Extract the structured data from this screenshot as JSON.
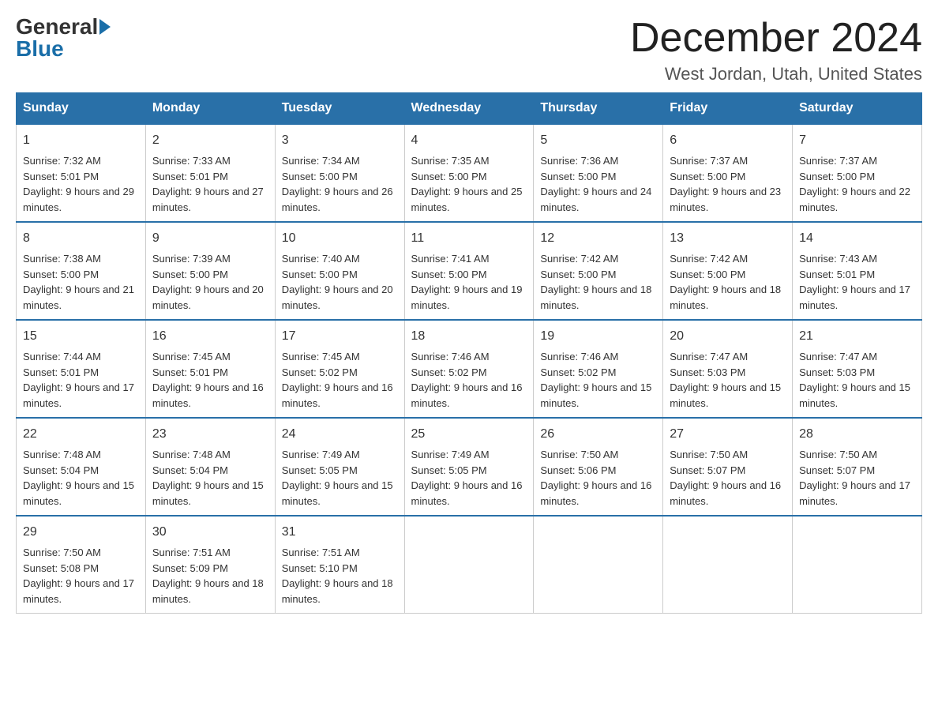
{
  "logo": {
    "general": "General",
    "blue": "Blue",
    "arrow": "▶"
  },
  "title": "December 2024",
  "location": "West Jordan, Utah, United States",
  "days_of_week": [
    "Sunday",
    "Monday",
    "Tuesday",
    "Wednesday",
    "Thursday",
    "Friday",
    "Saturday"
  ],
  "weeks": [
    [
      {
        "day": "1",
        "sunrise": "7:32 AM",
        "sunset": "5:01 PM",
        "daylight": "9 hours and 29 minutes."
      },
      {
        "day": "2",
        "sunrise": "7:33 AM",
        "sunset": "5:01 PM",
        "daylight": "9 hours and 27 minutes."
      },
      {
        "day": "3",
        "sunrise": "7:34 AM",
        "sunset": "5:00 PM",
        "daylight": "9 hours and 26 minutes."
      },
      {
        "day": "4",
        "sunrise": "7:35 AM",
        "sunset": "5:00 PM",
        "daylight": "9 hours and 25 minutes."
      },
      {
        "day": "5",
        "sunrise": "7:36 AM",
        "sunset": "5:00 PM",
        "daylight": "9 hours and 24 minutes."
      },
      {
        "day": "6",
        "sunrise": "7:37 AM",
        "sunset": "5:00 PM",
        "daylight": "9 hours and 23 minutes."
      },
      {
        "day": "7",
        "sunrise": "7:37 AM",
        "sunset": "5:00 PM",
        "daylight": "9 hours and 22 minutes."
      }
    ],
    [
      {
        "day": "8",
        "sunrise": "7:38 AM",
        "sunset": "5:00 PM",
        "daylight": "9 hours and 21 minutes."
      },
      {
        "day": "9",
        "sunrise": "7:39 AM",
        "sunset": "5:00 PM",
        "daylight": "9 hours and 20 minutes."
      },
      {
        "day": "10",
        "sunrise": "7:40 AM",
        "sunset": "5:00 PM",
        "daylight": "9 hours and 20 minutes."
      },
      {
        "day": "11",
        "sunrise": "7:41 AM",
        "sunset": "5:00 PM",
        "daylight": "9 hours and 19 minutes."
      },
      {
        "day": "12",
        "sunrise": "7:42 AM",
        "sunset": "5:00 PM",
        "daylight": "9 hours and 18 minutes."
      },
      {
        "day": "13",
        "sunrise": "7:42 AM",
        "sunset": "5:00 PM",
        "daylight": "9 hours and 18 minutes."
      },
      {
        "day": "14",
        "sunrise": "7:43 AM",
        "sunset": "5:01 PM",
        "daylight": "9 hours and 17 minutes."
      }
    ],
    [
      {
        "day": "15",
        "sunrise": "7:44 AM",
        "sunset": "5:01 PM",
        "daylight": "9 hours and 17 minutes."
      },
      {
        "day": "16",
        "sunrise": "7:45 AM",
        "sunset": "5:01 PM",
        "daylight": "9 hours and 16 minutes."
      },
      {
        "day": "17",
        "sunrise": "7:45 AM",
        "sunset": "5:02 PM",
        "daylight": "9 hours and 16 minutes."
      },
      {
        "day": "18",
        "sunrise": "7:46 AM",
        "sunset": "5:02 PM",
        "daylight": "9 hours and 16 minutes."
      },
      {
        "day": "19",
        "sunrise": "7:46 AM",
        "sunset": "5:02 PM",
        "daylight": "9 hours and 15 minutes."
      },
      {
        "day": "20",
        "sunrise": "7:47 AM",
        "sunset": "5:03 PM",
        "daylight": "9 hours and 15 minutes."
      },
      {
        "day": "21",
        "sunrise": "7:47 AM",
        "sunset": "5:03 PM",
        "daylight": "9 hours and 15 minutes."
      }
    ],
    [
      {
        "day": "22",
        "sunrise": "7:48 AM",
        "sunset": "5:04 PM",
        "daylight": "9 hours and 15 minutes."
      },
      {
        "day": "23",
        "sunrise": "7:48 AM",
        "sunset": "5:04 PM",
        "daylight": "9 hours and 15 minutes."
      },
      {
        "day": "24",
        "sunrise": "7:49 AM",
        "sunset": "5:05 PM",
        "daylight": "9 hours and 15 minutes."
      },
      {
        "day": "25",
        "sunrise": "7:49 AM",
        "sunset": "5:05 PM",
        "daylight": "9 hours and 16 minutes."
      },
      {
        "day": "26",
        "sunrise": "7:50 AM",
        "sunset": "5:06 PM",
        "daylight": "9 hours and 16 minutes."
      },
      {
        "day": "27",
        "sunrise": "7:50 AM",
        "sunset": "5:07 PM",
        "daylight": "9 hours and 16 minutes."
      },
      {
        "day": "28",
        "sunrise": "7:50 AM",
        "sunset": "5:07 PM",
        "daylight": "9 hours and 17 minutes."
      }
    ],
    [
      {
        "day": "29",
        "sunrise": "7:50 AM",
        "sunset": "5:08 PM",
        "daylight": "9 hours and 17 minutes."
      },
      {
        "day": "30",
        "sunrise": "7:51 AM",
        "sunset": "5:09 PM",
        "daylight": "9 hours and 18 minutes."
      },
      {
        "day": "31",
        "sunrise": "7:51 AM",
        "sunset": "5:10 PM",
        "daylight": "9 hours and 18 minutes."
      },
      null,
      null,
      null,
      null
    ]
  ]
}
